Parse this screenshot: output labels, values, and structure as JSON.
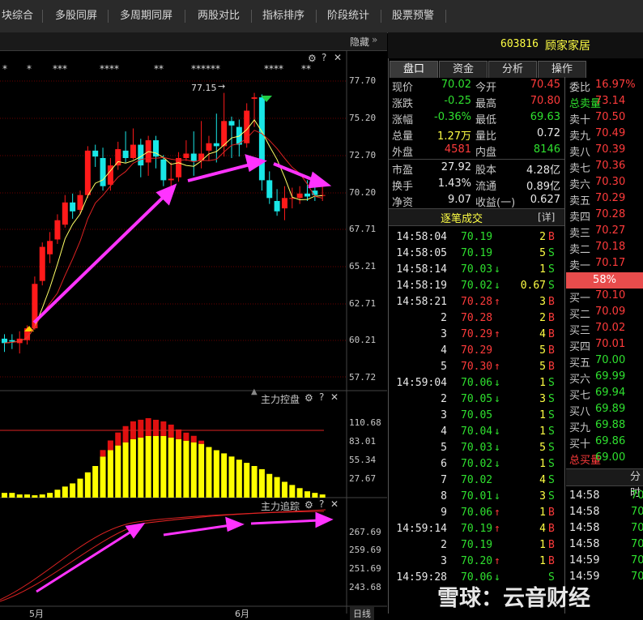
{
  "menu": {
    "items": [
      "块综合",
      "多股同屏",
      "多周期同屏",
      "两股对比",
      "指标排序",
      "阶段统计",
      "股票预警"
    ]
  },
  "left": {
    "hide_label": "隐藏",
    "stars": [
      "*",
      "*",
      "***",
      "****",
      "**",
      "******",
      "****",
      "**"
    ],
    "price_axis": [
      "77.70",
      "75.20",
      "72.70",
      "70.20",
      "67.71",
      "65.21",
      "62.71",
      "60.21",
      "57.72"
    ],
    "high_label": "77.15",
    "panel2_title": "主力控盘",
    "panel2_axis": [
      "110.68",
      "83.01",
      "55.34",
      "27.67"
    ],
    "panel3_title": "主力追踪",
    "panel3_axis": [
      "267.69",
      "259.69",
      "251.69",
      "243.68"
    ],
    "x_labels": [
      "5月",
      "6月"
    ],
    "day_label": "日线",
    "icons": [
      "gear-icon",
      "help-icon",
      "close-icon"
    ],
    "colors": {
      "up": "#ff1a1a",
      "down": "#19e6e6",
      "ma1": "#ffff66",
      "ma2": "#d22",
      "arrow": "#ff33ff",
      "ctrl_red": "#e01010",
      "ctrl_yellow": "#ffff00"
    }
  },
  "stock": {
    "code": "603816",
    "name": "顾家家居"
  },
  "tabs": [
    "盘口",
    "资金",
    "分析",
    "操作"
  ],
  "quote": {
    "rows": [
      {
        "l1": "现价",
        "v1": "70.02",
        "c1": "green",
        "l2": "今开",
        "v2": "70.45",
        "c2": "red"
      },
      {
        "l1": "涨跌",
        "v1": "-0.25",
        "c1": "green",
        "l2": "最高",
        "v2": "70.80",
        "c2": "red"
      },
      {
        "l1": "涨幅",
        "v1": "-0.36%",
        "c1": "green",
        "l2": "最低",
        "v2": "69.63",
        "c2": "green"
      },
      {
        "l1": "总量",
        "v1": "1.27万",
        "c1": "yellow",
        "l2": "量比",
        "v2": "0.72",
        "c2": "white"
      },
      {
        "l1": "外盘",
        "v1": "4581",
        "c1": "red",
        "l2": "内盘",
        "v2": "8146",
        "c2": "green"
      },
      {
        "l1": "市盈",
        "v1": "27.92",
        "c1": "white",
        "l2": "股本",
        "v2": "4.28亿",
        "c2": "white"
      },
      {
        "l1": "换手",
        "v1": "1.43%",
        "c1": "white",
        "l2": "流通",
        "v2": "0.89亿",
        "c2": "white"
      },
      {
        "l1": "净资",
        "v1": "9.07",
        "c1": "white",
        "l2": "收益(一)",
        "v2": "0.627",
        "c2": "white"
      }
    ]
  },
  "ticks": {
    "title": "逐笔成交",
    "detail": "[详]",
    "rows": [
      {
        "t": "14:58:04",
        "p": "70.19",
        "pc": "green",
        "a": "",
        "v": "2",
        "s": "B"
      },
      {
        "t": "14:58:05",
        "p": "70.19",
        "pc": "green",
        "a": "",
        "v": "5",
        "s": "S"
      },
      {
        "t": "14:58:14",
        "p": "70.03",
        "pc": "green",
        "a": "↓",
        "v": "1",
        "s": "S"
      },
      {
        "t": "14:58:19",
        "p": "70.02",
        "pc": "green",
        "a": "↓",
        "v": "0.67",
        "s": "S"
      },
      {
        "t": "14:58:21",
        "p": "70.28",
        "pc": "red",
        "a": "↑",
        "v": "3",
        "s": "B"
      },
      {
        "t": "2",
        "p": "70.28",
        "pc": "red",
        "a": "",
        "v": "2",
        "s": "B"
      },
      {
        "t": "3",
        "p": "70.29",
        "pc": "red",
        "a": "↑",
        "v": "4",
        "s": "B"
      },
      {
        "t": "4",
        "p": "70.29",
        "pc": "red",
        "a": "",
        "v": "5",
        "s": "B"
      },
      {
        "t": "5",
        "p": "70.30",
        "pc": "red",
        "a": "↑",
        "v": "5",
        "s": "B"
      },
      {
        "t": "14:59:04",
        "p": "70.06",
        "pc": "green",
        "a": "↓",
        "v": "1",
        "s": "S"
      },
      {
        "t": "2",
        "p": "70.05",
        "pc": "green",
        "a": "↓",
        "v": "3",
        "s": "S"
      },
      {
        "t": "3",
        "p": "70.05",
        "pc": "green",
        "a": "",
        "v": "1",
        "s": "S"
      },
      {
        "t": "4",
        "p": "70.04",
        "pc": "green",
        "a": "↓",
        "v": "1",
        "s": "S"
      },
      {
        "t": "5",
        "p": "70.03",
        "pc": "green",
        "a": "↓",
        "v": "5",
        "s": "S"
      },
      {
        "t": "6",
        "p": "70.02",
        "pc": "green",
        "a": "↓",
        "v": "1",
        "s": "S"
      },
      {
        "t": "7",
        "p": "70.02",
        "pc": "green",
        "a": "",
        "v": "4",
        "s": "S"
      },
      {
        "t": "8",
        "p": "70.01",
        "pc": "green",
        "a": "↓",
        "v": "3",
        "s": "S"
      },
      {
        "t": "9",
        "p": "70.06",
        "pc": "green",
        "a": "↑",
        "v": "1",
        "s": "B"
      },
      {
        "t": "14:59:14",
        "p": "70.19",
        "pc": "green",
        "a": "↑",
        "v": "4",
        "s": "B"
      },
      {
        "t": "2",
        "p": "70.19",
        "pc": "green",
        "a": "",
        "v": "1",
        "s": "B"
      },
      {
        "t": "3",
        "p": "70.20",
        "pc": "green",
        "a": "↑",
        "v": "1",
        "s": "B"
      },
      {
        "t": "14:59:28",
        "p": "70.06",
        "pc": "green",
        "a": "↓",
        "v": "",
        "s": "S"
      }
    ]
  },
  "orderbook": {
    "ratio_label": "委比",
    "ratio_value": "16.97%",
    "total_sell_label": "总卖量",
    "total_sell_value": "73.14",
    "sells": [
      {
        "l": "卖十",
        "p": "70.50"
      },
      {
        "l": "卖九",
        "p": "70.49"
      },
      {
        "l": "卖八",
        "p": "70.39"
      },
      {
        "l": "卖七",
        "p": "70.36"
      },
      {
        "l": "卖六",
        "p": "70.30"
      },
      {
        "l": "卖五",
        "p": "70.29"
      },
      {
        "l": "卖四",
        "p": "70.28"
      },
      {
        "l": "卖三",
        "p": "70.27"
      },
      {
        "l": "卖二",
        "p": "70.18"
      },
      {
        "l": "卖一",
        "p": "70.17"
      }
    ],
    "bar_pct": "58%",
    "buys": [
      {
        "l": "买一",
        "p": "70.10"
      },
      {
        "l": "买二",
        "p": "70.09"
      },
      {
        "l": "买三",
        "p": "70.02"
      },
      {
        "l": "买四",
        "p": "70.01"
      },
      {
        "l": "买五",
        "p": "70.00"
      },
      {
        "l": "买六",
        "p": "69.99"
      },
      {
        "l": "买七",
        "p": "69.94"
      },
      {
        "l": "买八",
        "p": "69.89"
      },
      {
        "l": "买九",
        "p": "69.88"
      },
      {
        "l": "买十",
        "p": "69.86"
      }
    ],
    "total_buy_label": "总买量",
    "total_buy_value": "69.00",
    "time_header": "分时",
    "time_rows": [
      {
        "t": "14:58",
        "p": "70"
      },
      {
        "t": "14:58",
        "p": "70"
      },
      {
        "t": "14:58",
        "p": "70"
      },
      {
        "t": "14:58",
        "p": "70"
      },
      {
        "t": "14:59",
        "p": "70"
      },
      {
        "t": "14:59",
        "p": "70"
      }
    ]
  },
  "watermark": "雪球：云音财经"
}
